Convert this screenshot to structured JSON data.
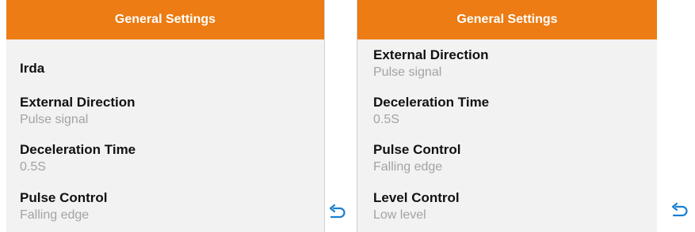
{
  "accent_color": "#ec7c13",
  "back_icon": "undo-arrow-icon",
  "left_panel": {
    "title": "General Settings",
    "items": [
      {
        "label": "Irda",
        "value": ""
      },
      {
        "label": "External Direction",
        "value": "Pulse signal"
      },
      {
        "label": "Deceleration Time",
        "value": "0.5S"
      },
      {
        "label": "Pulse Control",
        "value": "Falling edge"
      }
    ]
  },
  "right_panel": {
    "title": "General Settings",
    "items": [
      {
        "label": "External Direction",
        "value": "Pulse signal"
      },
      {
        "label": "Deceleration Time",
        "value": "0.5S"
      },
      {
        "label": "Pulse Control",
        "value": "Falling edge"
      },
      {
        "label": "Level Control",
        "value": "Low level"
      }
    ]
  }
}
